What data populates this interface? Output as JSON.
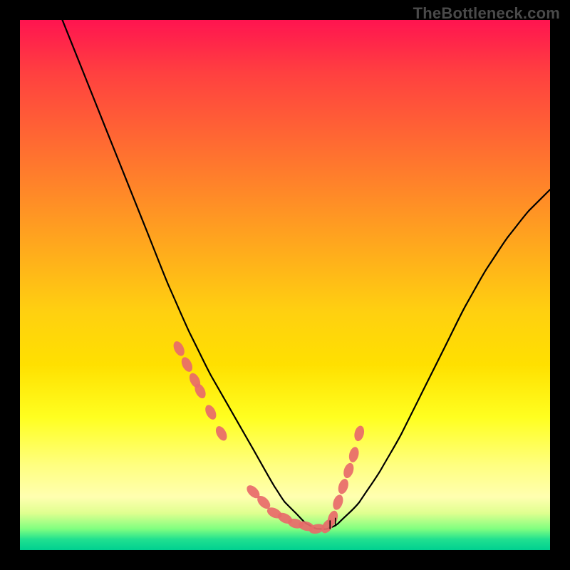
{
  "watermark": "TheBottleneck.com",
  "chart_data": {
    "type": "line",
    "title": "",
    "xlabel": "",
    "ylabel": "",
    "xlim": [
      0,
      100
    ],
    "ylim": [
      0,
      100
    ],
    "series": [
      {
        "name": "bottleneck-curve",
        "x": [
          8,
          12,
          16,
          20,
          24,
          28,
          32,
          36,
          40,
          44,
          48,
          50,
          52,
          54,
          56,
          58,
          60,
          64,
          68,
          72,
          76,
          80,
          84,
          88,
          92,
          96,
          100
        ],
        "y": [
          100,
          90,
          80,
          70,
          60,
          50,
          41,
          33,
          26,
          19,
          12,
          9,
          7,
          5,
          4,
          4,
          5,
          9,
          15,
          22,
          30,
          38,
          46,
          53,
          59,
          64,
          68
        ]
      }
    ],
    "overlay_points": {
      "name": "highlight-dots",
      "color": "#e86a6a",
      "x": [
        30,
        31.5,
        33,
        34,
        36,
        38,
        44,
        46,
        48,
        50,
        52,
        54,
        56,
        58,
        59,
        60,
        61,
        62,
        63,
        64
      ],
      "y": [
        38,
        35,
        32,
        30,
        26,
        22,
        11,
        9,
        7,
        6,
        5,
        4.5,
        4,
        4.5,
        6,
        9,
        12,
        15,
        18,
        22
      ]
    },
    "gradient_stops": [
      {
        "pos": 0,
        "color": "#ff1450"
      },
      {
        "pos": 25,
        "color": "#ff7030"
      },
      {
        "pos": 55,
        "color": "#ffd010"
      },
      {
        "pos": 80,
        "color": "#ffff60"
      },
      {
        "pos": 96,
        "color": "#60ff80"
      },
      {
        "pos": 100,
        "color": "#00d090"
      }
    ]
  }
}
